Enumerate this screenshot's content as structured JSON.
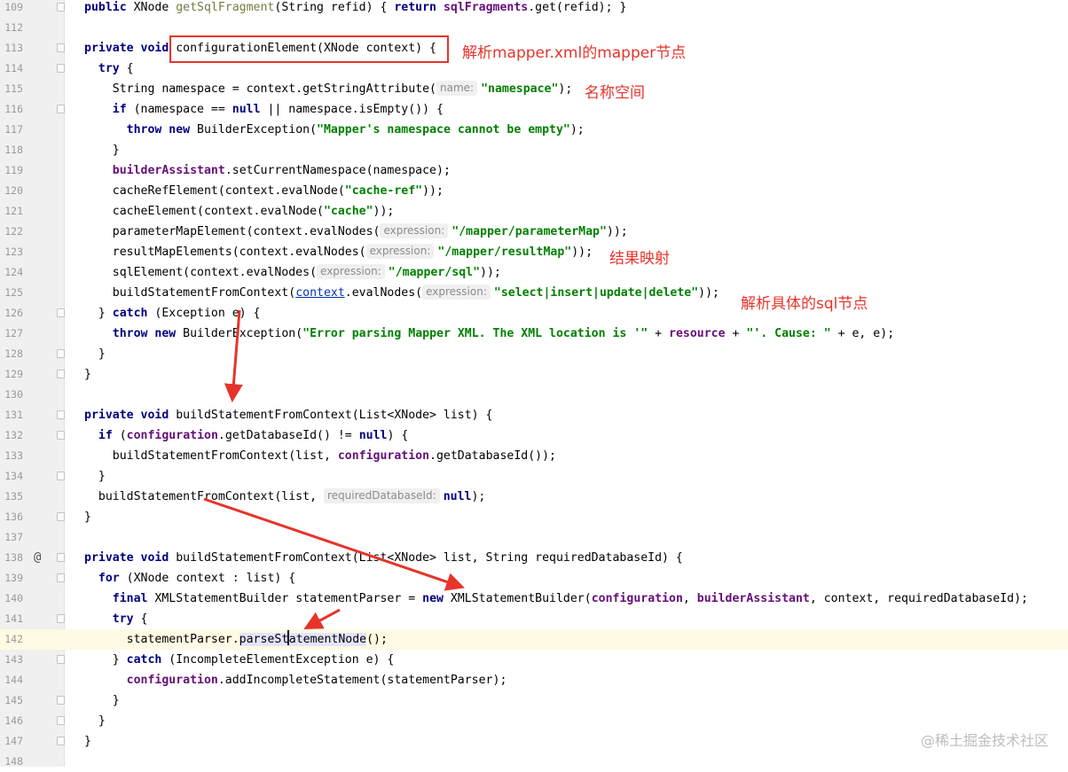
{
  "editor": {
    "lines": [
      {
        "num": "109",
        "fold": true,
        "html": "<span class=\"kw\">public</span> XNode <span class=\"meth\">getSqlFragment</span>(String refid) { <span class=\"kw\">return</span> <span class=\"fld\">sqlFragments</span>.get(refid); }"
      },
      {
        "num": "112",
        "fold": false,
        "html": ""
      },
      {
        "num": "113",
        "fold": true,
        "html": "<span class=\"kw\">private void</span> configurationElement(XNode context) {"
      },
      {
        "num": "114",
        "fold": true,
        "html": "  <span class=\"kw\">try</span> {"
      },
      {
        "num": "115",
        "fold": false,
        "html": "    String namespace = context.getStringAttribute(<span class=\"hint\">name:</span><span class=\"str\">\"namespace\"</span>);"
      },
      {
        "num": "116",
        "fold": true,
        "html": "    <span class=\"kw\">if</span> (namespace == <span class=\"kw\">null</span> || namespace.isEmpty()) {"
      },
      {
        "num": "117",
        "fold": false,
        "html": "      <span class=\"kw\">throw new</span> BuilderException(<span class=\"str\">\"Mapper's namespace cannot be empty\"</span>);"
      },
      {
        "num": "118",
        "fold": false,
        "html": "    }"
      },
      {
        "num": "119",
        "fold": false,
        "html": "    <span class=\"fld\">builderAssistant</span>.setCurrentNamespace(namespace);"
      },
      {
        "num": "120",
        "fold": false,
        "html": "    cacheRefElement(context.evalNode(<span class=\"str\">\"cache-ref\"</span>));"
      },
      {
        "num": "121",
        "fold": false,
        "html": "    cacheElement(context.evalNode(<span class=\"str\">\"cache\"</span>));"
      },
      {
        "num": "122",
        "fold": false,
        "html": "    parameterMapElement(context.evalNodes(<span class=\"hint\">expression:</span><span class=\"str\">\"/mapper/parameterMap\"</span>));"
      },
      {
        "num": "123",
        "fold": false,
        "html": "    resultMapElements(context.evalNodes(<span class=\"hint\">expression:</span><span class=\"str\">\"/mapper/resultMap\"</span>));"
      },
      {
        "num": "124",
        "fold": false,
        "html": "    sqlElement(context.evalNodes(<span class=\"hint\">expression:</span><span class=\"str\">\"/mapper/sql\"</span>));"
      },
      {
        "num": "125",
        "fold": false,
        "html": "    buildStatementFromContext(<span class=\"lnk\">context</span>.evalNodes(<span class=\"hint\">expression:</span><span class=\"str\">\"select|insert|update|delete\"</span>));"
      },
      {
        "num": "126",
        "fold": true,
        "html": "  } <span class=\"kw\">catch</span> (Exception e) {"
      },
      {
        "num": "127",
        "fold": false,
        "html": "    <span class=\"kw\">throw new</span> BuilderException(<span class=\"str\">\"Error parsing Mapper XML. The XML location is '\"</span> + <span class=\"fld\">resource</span> + <span class=\"str\">\"'. Cause: \"</span> + e, e);"
      },
      {
        "num": "128",
        "fold": true,
        "html": "  }"
      },
      {
        "num": "129",
        "fold": true,
        "html": "}"
      },
      {
        "num": "130",
        "fold": false,
        "html": ""
      },
      {
        "num": "131",
        "fold": true,
        "html": "<span class=\"kw\">private void</span> buildStatementFromContext(List&lt;XNode&gt; list) {"
      },
      {
        "num": "132",
        "fold": true,
        "html": "  <span class=\"kw\">if</span> (<span class=\"fld\">configuration</span>.getDatabaseId() != <span class=\"kw\">null</span>) {"
      },
      {
        "num": "133",
        "fold": false,
        "html": "    buildStatementFromContext(list, <span class=\"fld\">configuration</span>.getDatabaseId());"
      },
      {
        "num": "134",
        "fold": true,
        "html": "  }"
      },
      {
        "num": "135",
        "fold": false,
        "html": "  buildStatementFromContext(list, <span class=\"hint\">requiredDatabaseId:</span><span class=\"kw\">null</span>);"
      },
      {
        "num": "136",
        "fold": true,
        "html": "}"
      },
      {
        "num": "137",
        "fold": false,
        "html": ""
      },
      {
        "num": "138",
        "fold": true,
        "mark": "@",
        "html": "<span class=\"kw\">private void</span> buildStatementFromContext(List&lt;XNode&gt; list, String requiredDatabaseId) {"
      },
      {
        "num": "139",
        "fold": true,
        "html": "  <span class=\"kw\">for</span> (XNode context : list) {"
      },
      {
        "num": "140",
        "fold": false,
        "html": "    <span class=\"kw\">final</span> XMLStatementBuilder statementParser = <span class=\"kw\">new</span> XMLStatementBuilder(<span class=\"fld\">configuration</span>, <span class=\"fld\">builderAssistant</span>, context, requiredDatabaseId);"
      },
      {
        "num": "141",
        "fold": true,
        "html": "    <span class=\"kw\">try</span> {"
      },
      {
        "num": "142",
        "fold": false,
        "current": true,
        "html": "      statementParser.<span class=\"hl\">parseSt<span class=\"caret\"></span>atementNode</span>();"
      },
      {
        "num": "143",
        "fold": true,
        "html": "    } <span class=\"kw\">catch</span> (IncompleteElementException e) {"
      },
      {
        "num": "144",
        "fold": false,
        "html": "      <span class=\"fld\">configuration</span>.addIncompleteStatement(statementParser);"
      },
      {
        "num": "145",
        "fold": true,
        "html": "    }"
      },
      {
        "num": "146",
        "fold": true,
        "html": "  }"
      },
      {
        "num": "147",
        "fold": true,
        "html": "}"
      },
      {
        "num": "148",
        "fold": false,
        "html": ""
      }
    ]
  },
  "annotations": {
    "note_mapper_node": "解析mapper.xml的mapper节点",
    "note_namespace": "名称空间",
    "note_result_map": "结果映射",
    "note_sql_node": "解析具体的sql节点"
  },
  "watermark": "@稀土掘金技术社区",
  "colors": {
    "annotation_red": "#e6342b",
    "keyword": "#000080",
    "string": "#008000",
    "field": "#660e7a"
  }
}
